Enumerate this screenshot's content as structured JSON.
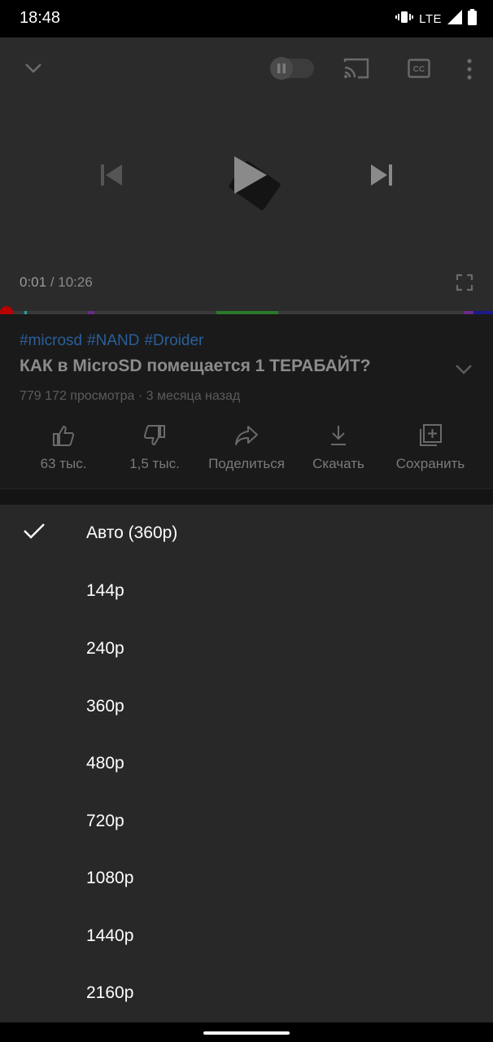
{
  "status_bar": {
    "time": "18:48",
    "network": "LTE",
    "icons": [
      "vibrate-icon",
      "signal-icon",
      "battery-icon"
    ]
  },
  "player": {
    "current_time": "0:01",
    "separator": " / ",
    "duration": "10:26",
    "progress_fraction": 0.013,
    "icons": [
      "collapse-chevron-icon",
      "autoplay-toggle",
      "cast-icon",
      "captions-icon",
      "more-vert-icon",
      "previous-icon",
      "play-icon",
      "next-icon",
      "fullscreen-icon"
    ]
  },
  "video": {
    "hashtags": [
      "#microsd",
      "#NAND",
      "#Droider"
    ],
    "title": "КАК в MicroSD помещается 1 ТЕРАБАЙТ?",
    "meta": "779 172 просмотра · 3 месяца назад"
  },
  "actions": {
    "like": "63 тыс.",
    "dislike": "1,5 тыс.",
    "share": "Поделиться",
    "download": "Скачать",
    "save": "Сохранить"
  },
  "quality_menu": {
    "selected_index": 0,
    "options": [
      "Авто (360p)",
      "144p",
      "240p",
      "360p",
      "480p",
      "720p",
      "1080p",
      "1440p",
      "2160p"
    ]
  },
  "colors": {
    "hashtag": "#2a5f9b",
    "progress": "#cc0000",
    "sheet_bg": "#282828"
  }
}
